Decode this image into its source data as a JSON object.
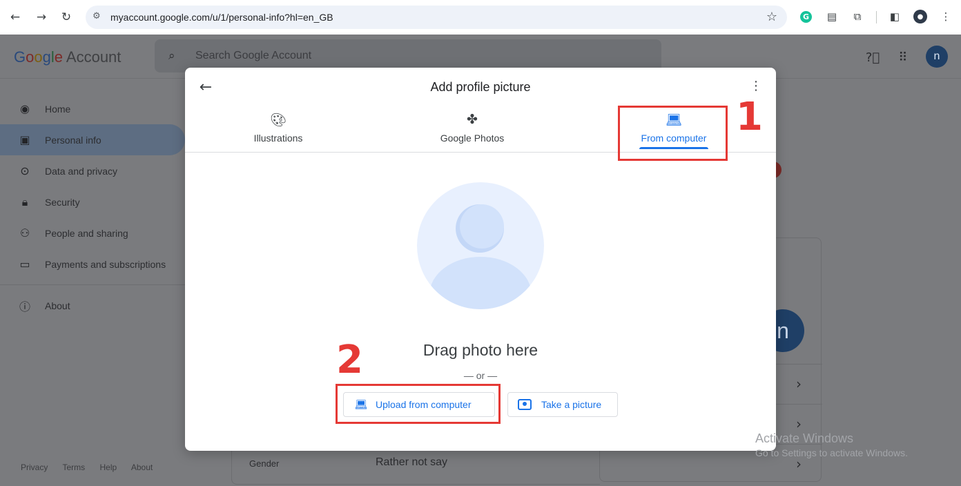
{
  "browser": {
    "url": "myaccount.google.com/u/1/personal-info?hl=en_GB",
    "icons": [
      "back-arrow-icon",
      "forward-arrow-icon",
      "reload-icon",
      "site-settings-icon",
      "bookmark-star-icon",
      "grammarly-icon",
      "extension-icon",
      "puzzle-icon",
      "side-panel-icon",
      "profile-icon",
      "kebab-menu-icon"
    ],
    "grammarly_letter": "G"
  },
  "header": {
    "logo_parts": [
      "G",
      "o",
      "o",
      "g",
      "l",
      "e"
    ],
    "logo_suffix": " Account",
    "search_placeholder": "Search Google Account",
    "avatar_letter": "n"
  },
  "sidebar": {
    "items": [
      {
        "label": "Home",
        "icon": "account-circle-icon"
      },
      {
        "label": "Personal info",
        "icon": "badge-icon",
        "active": true
      },
      {
        "label": "Data and privacy",
        "icon": "toggle-icon"
      },
      {
        "label": "Security",
        "icon": "lock-icon"
      },
      {
        "label": "People and sharing",
        "icon": "people-icon"
      },
      {
        "label": "Payments and subscriptions",
        "icon": "credit-card-icon"
      }
    ],
    "about": "About",
    "footer": [
      "Privacy",
      "Terms",
      "Help",
      "About"
    ]
  },
  "background": {
    "avatar_letter": "n",
    "gender_label": "Gender",
    "gender_value": "Rather not say",
    "watermark_title": "Activate Windows",
    "watermark_sub": "Go to Settings to activate Windows."
  },
  "modal": {
    "title": "Add profile picture",
    "tabs": [
      {
        "label": "Illustrations",
        "icon": "palette-icon"
      },
      {
        "label": "Google Photos",
        "icon": "pinwheel-icon"
      },
      {
        "label": "From computer",
        "icon": "laptop-icon",
        "active": true
      }
    ],
    "drag_text": "Drag photo here",
    "or_text": "— or —",
    "upload_button": "Upload from computer",
    "camera_button": "Take a picture"
  },
  "annotations": {
    "step1": "1",
    "step2": "2",
    "color": "#e53935"
  },
  "colors": {
    "accent": "#1a73e8",
    "overlay": "#7a7b7e"
  }
}
